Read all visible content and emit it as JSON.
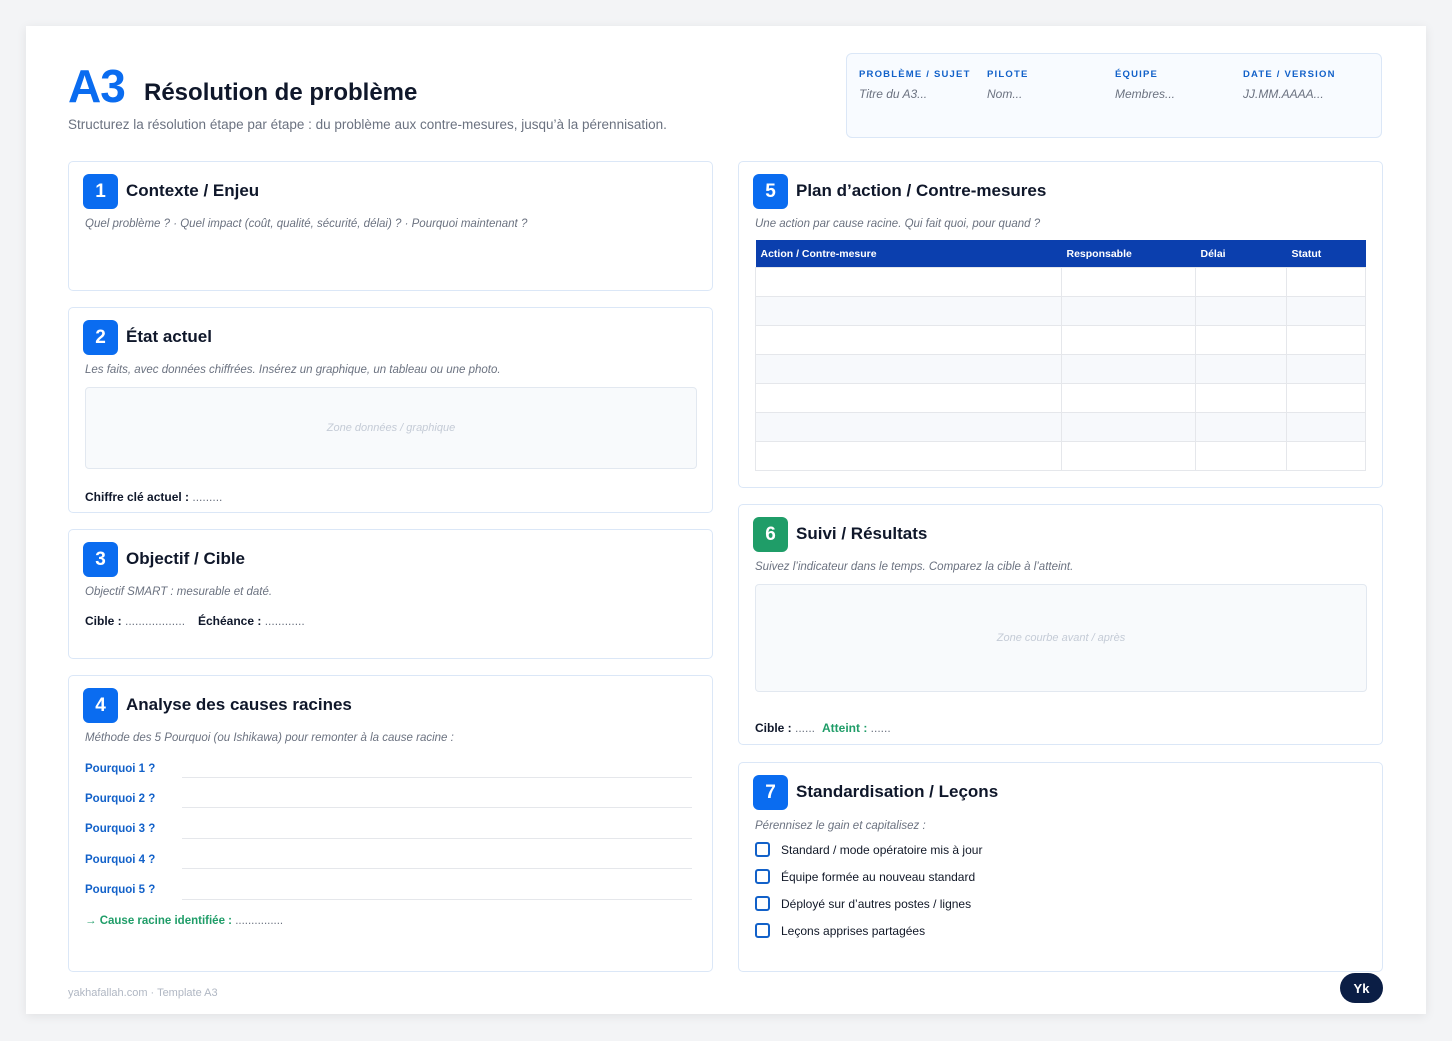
{
  "header": {
    "brand": "A3",
    "title": "Résolution de problème",
    "subtitle": "Structurez la résolution étape par étape : du problème aux contre-mesures, jusqu’à la pérennisation."
  },
  "meta": [
    {
      "label": "PROBLÈME / SUJET",
      "value": "Titre du A3..."
    },
    {
      "label": "PILOTE",
      "value": "Nom..."
    },
    {
      "label": "ÉQUIPE",
      "value": "Membres..."
    },
    {
      "label": "DATE / VERSION",
      "value": "JJ.MM.AAAA..."
    }
  ],
  "s1": {
    "num": "1",
    "title": "Contexte / Enjeu",
    "hint": "Quel problème ? · Quel impact (coût, qualité, sécurité, délai) ? · Pourquoi maintenant ?"
  },
  "s2": {
    "num": "2",
    "title": "État actuel",
    "hint": "Les faits, avec données chiffrées. Insérez un graphique, un tableau ou une photo.",
    "zone": "Zone données / graphique",
    "key_label": "Chiffre clé actuel :",
    "key_value": "........."
  },
  "s3": {
    "num": "3",
    "title": "Objectif / Cible",
    "hint": "Objectif SMART : mesurable et daté.",
    "target_label": "Cible :",
    "target_value": "..................",
    "deadline_label": "Échéance :",
    "deadline_value": "............"
  },
  "s4": {
    "num": "4",
    "title": "Analyse des causes racines",
    "hint": "Méthode des 5 Pourquoi (ou Ishikawa) pour remonter à la cause racine :",
    "whys": [
      "Pourquoi 1 ?",
      "Pourquoi 2 ?",
      "Pourquoi 3 ?",
      "Pourquoi 4 ?",
      "Pourquoi 5 ?"
    ],
    "root_label": "→ Cause racine identifiée :",
    "root_value": "..............."
  },
  "s5": {
    "num": "5",
    "title": "Plan d’action / Contre-mesures",
    "hint": "Une action par cause racine. Qui fait quoi, pour quand ?",
    "columns": [
      "Action / Contre-mesure",
      "Responsable",
      "Délai",
      "Statut"
    ],
    "rows": [
      [
        "",
        "",
        "",
        ""
      ],
      [
        "",
        "",
        "",
        ""
      ],
      [
        "",
        "",
        "",
        ""
      ],
      [
        "",
        "",
        "",
        ""
      ],
      [
        "",
        "",
        "",
        ""
      ],
      [
        "",
        "",
        "",
        ""
      ],
      [
        "",
        "",
        "",
        ""
      ]
    ]
  },
  "s6": {
    "num": "6",
    "title": "Suivi / Résultats",
    "hint": "Suivez l’indicateur dans le temps. Comparez la cible à l’atteint.",
    "zone": "Zone courbe avant / après",
    "target_label": "Cible :",
    "target_value": "......",
    "achieved_label": "Atteint :",
    "achieved_value": "......"
  },
  "s7": {
    "num": "7",
    "title": "Standardisation / Leçons",
    "hint": "Pérennisez le gain et capitalisez :",
    "items": [
      "Standard / mode opératoire mis à jour",
      "Équipe formée au nouveau standard",
      "Déployé sur d’autres postes / lignes",
      "Leçons apprises partagées"
    ]
  },
  "footer": {
    "text": "yakhafallah.com · Template A3",
    "logo": "Yk"
  },
  "colors": {
    "accent": "#0a6cf0",
    "green": "#1f9d68",
    "table_header": "#0b3fae",
    "logo_bg": "#0b1e45"
  }
}
